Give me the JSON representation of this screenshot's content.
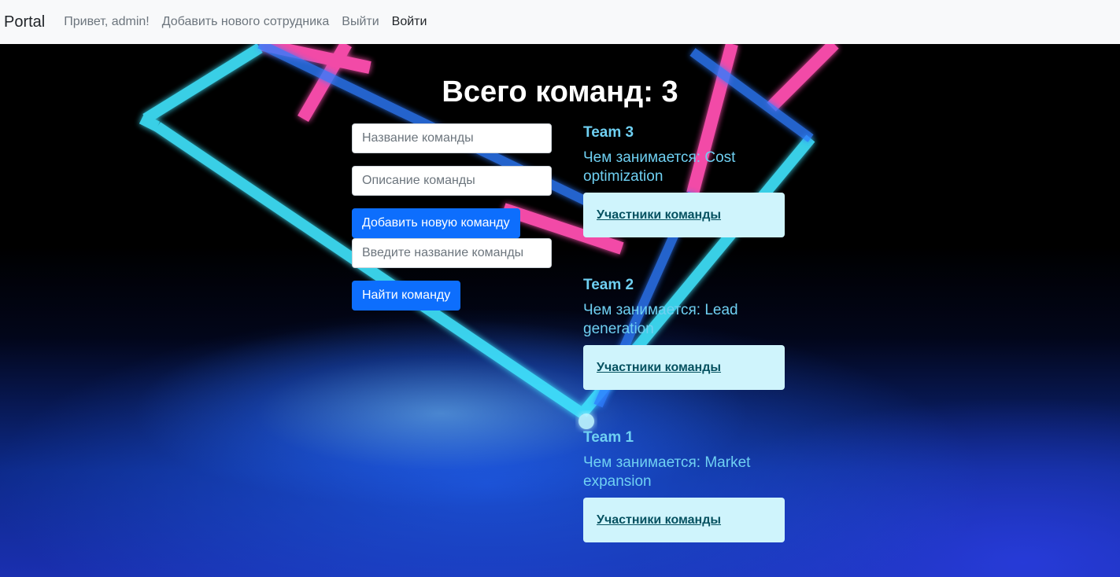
{
  "navbar": {
    "brand": "Portal",
    "greeting": "Привет, admin!",
    "add_employee": "Добавить нового сотрудника",
    "logout": "Выйти",
    "login": "Войти"
  },
  "main": {
    "title": "Всего команд: 3",
    "form": {
      "team_name_placeholder": "Название команды",
      "team_desc_placeholder": "Описание команды",
      "add_button": "Добавить новую команду",
      "search_placeholder": "Введите название команды",
      "search_button": "Найти команду"
    },
    "teams": [
      {
        "name": "Team 3",
        "description": "Чем занимается: Cost optimization",
        "members_link": "Участники команды"
      },
      {
        "name": "Team 2",
        "description": "Чем занимается: Lead generation",
        "members_link": "Участники команды"
      },
      {
        "name": "Team 1",
        "description": "Чем занимается: Market expansion",
        "members_link": "Участники команды"
      }
    ]
  },
  "colors": {
    "primary": "#0d6efd",
    "team_text": "#6fd0f2",
    "members_box": "#cff4fc",
    "members_link": "#055160",
    "navbar_bg": "#f8f9fa"
  }
}
